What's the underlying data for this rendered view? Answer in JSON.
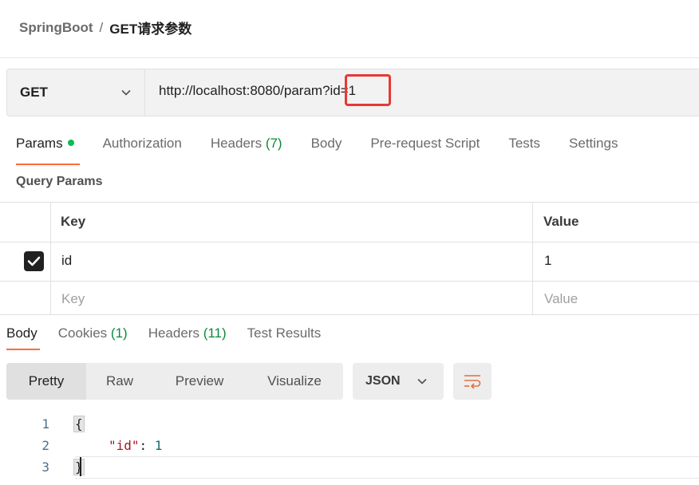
{
  "breadcrumb": {
    "parent": "SpringBoot",
    "separator": "/",
    "current": "GET请求参数"
  },
  "request": {
    "method": "GET",
    "url": "http://localhost:8080/param?id=1"
  },
  "tabs": {
    "params": "Params",
    "authorization": "Authorization",
    "headers": "Headers",
    "headers_count": "(7)",
    "body": "Body",
    "prerequest": "Pre-request Script",
    "tests": "Tests",
    "settings": "Settings"
  },
  "query_params": {
    "title": "Query Params",
    "key_header": "Key",
    "value_header": "Value",
    "rows": [
      {
        "key": "id",
        "value": "1",
        "checked": true
      }
    ],
    "key_placeholder": "Key",
    "value_placeholder": "Value"
  },
  "response_tabs": {
    "body": "Body",
    "cookies": "Cookies",
    "cookies_count": "(1)",
    "headers": "Headers",
    "headers_count": "(11)",
    "test_results": "Test Results"
  },
  "view_modes": {
    "pretty": "Pretty",
    "raw": "Raw",
    "preview": "Preview",
    "visualize": "Visualize"
  },
  "format": "JSON",
  "response_code": {
    "line_numbers": [
      "1",
      "2",
      "3"
    ],
    "open_brace": "{",
    "key": "\"id\"",
    "colon": ": ",
    "value": "1",
    "close_brace": "}"
  },
  "colors": {
    "accent": "#ff6c37",
    "highlight_box": "#e53935",
    "dot": "#0cbb52"
  }
}
